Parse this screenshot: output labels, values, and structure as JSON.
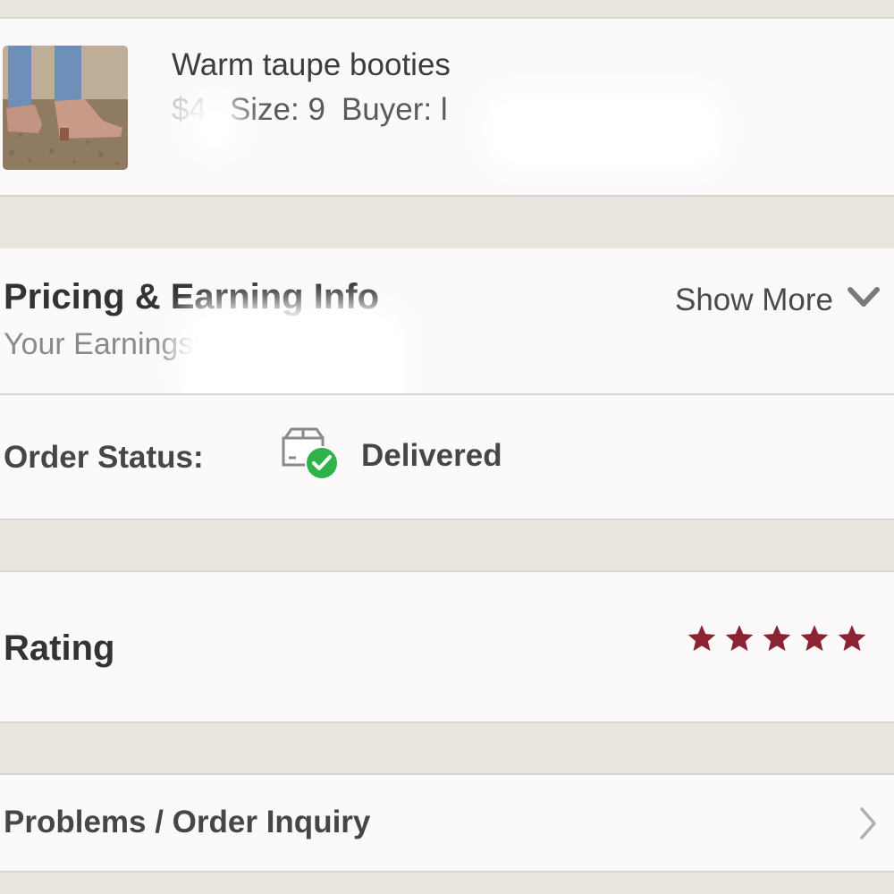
{
  "item": {
    "title": "Warm taupe booties",
    "price_prefix": "$4",
    "size_text": "Size: 9",
    "buyer_text": "Buyer: l"
  },
  "pricing": {
    "title": "Pricing & Earning Info",
    "earnings_text": "Your Earnings: $",
    "show_more": "Show More",
    "chevron_icon": "chevron-down-icon"
  },
  "order_status": {
    "label": "Order Status:",
    "value": "Delivered",
    "icon": "box-delivered-icon",
    "check_color": "#2fb24a"
  },
  "rating": {
    "label": "Rating",
    "stars": 5,
    "max_stars": 5,
    "star_color": "#8b2332"
  },
  "problems": {
    "label": "Problems / Order Inquiry",
    "chevron_icon": "chevron-right-icon"
  }
}
